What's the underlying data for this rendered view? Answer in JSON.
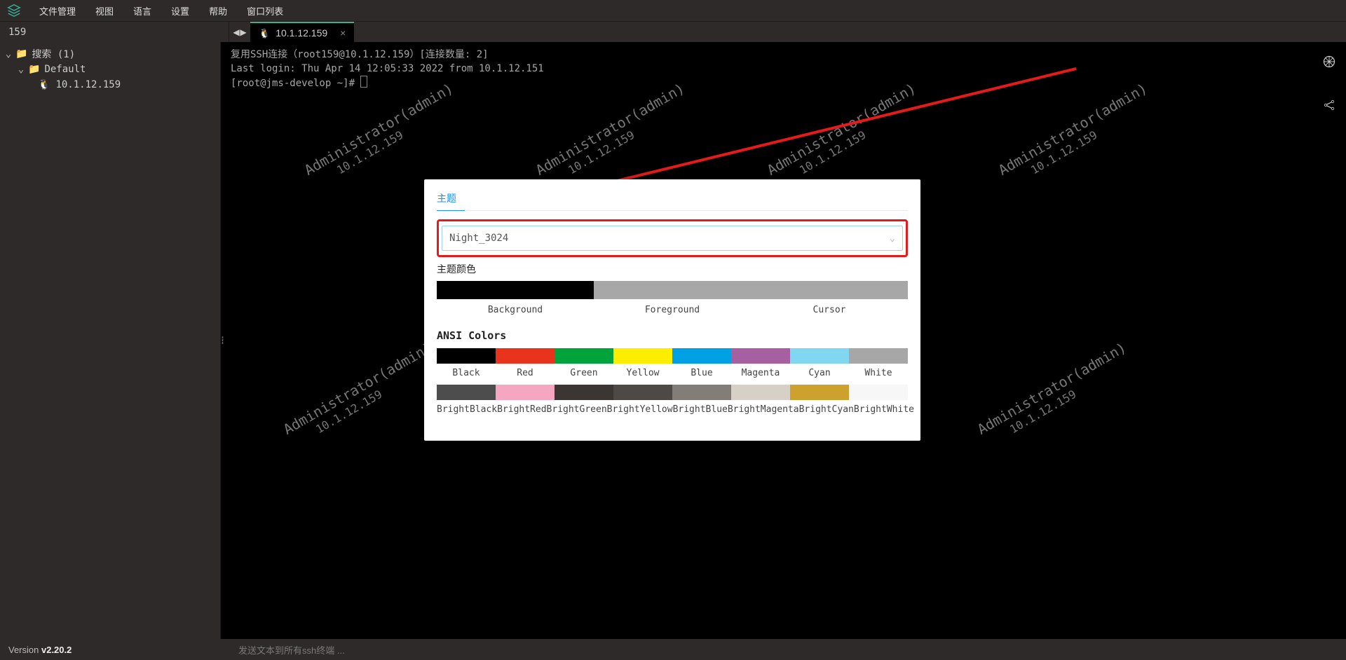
{
  "menu": {
    "items": [
      "文件管理",
      "视图",
      "语言",
      "设置",
      "帮助",
      "窗口列表"
    ]
  },
  "sidebar_title": "159",
  "tab": {
    "label": "10.1.12.159"
  },
  "tree": {
    "root_label": "搜索 (1)",
    "group_label": "Default",
    "host_label": "10.1.12.159"
  },
  "terminal": {
    "l1": "复用SSH连接（root159@10.1.12.159）[连接数量: 2]",
    "l2": "Last login: Thu Apr 14 12:05:33 2022 from 10.1.12.151",
    "l3": "[root@jms-develop ~]# "
  },
  "watermark": {
    "line1": "Administrator(admin)",
    "line2": "10.1.12.159"
  },
  "modal": {
    "title": "主题",
    "select_value": "Night_3024",
    "theme_color_label": "主题颜色",
    "swatches": [
      {
        "label": "Background",
        "color": "#000000"
      },
      {
        "label": "Foreground",
        "color": "#a7a7a7"
      },
      {
        "label": "Cursor",
        "color": "#a7a7a7"
      }
    ],
    "ansi_title": "ANSI Colors",
    "ansi": [
      {
        "label": "Black",
        "color": "#000000"
      },
      {
        "label": "Red",
        "color": "#e8341c"
      },
      {
        "label": "Green",
        "color": "#00a43a"
      },
      {
        "label": "Yellow",
        "color": "#ffed00"
      },
      {
        "label": "Blue",
        "color": "#00a0e4"
      },
      {
        "label": "Magenta",
        "color": "#a65fa1"
      },
      {
        "label": "Cyan",
        "color": "#81d7ef"
      },
      {
        "label": "White",
        "color": "#a7a7a7"
      }
    ],
    "ansi_bright": [
      {
        "label": "BrightBlack",
        "color": "#4d4d4d"
      },
      {
        "label": "BrightRed",
        "color": "#f5a6c0"
      },
      {
        "label": "BrightGreen",
        "color": "#3b3633"
      },
      {
        "label": "BrightYellow",
        "color": "#4d4945"
      },
      {
        "label": "BrightBlue",
        "color": "#837d77"
      },
      {
        "label": "BrightMagenta",
        "color": "#d6d0c6"
      },
      {
        "label": "BrightCyan",
        "color": "#cda12e"
      },
      {
        "label": "BrightWhite",
        "color": "#f7f7f7"
      }
    ]
  },
  "footer": {
    "version_prefix": "Version ",
    "version": "v2.20.2",
    "sendall": "发送文本到所有ssh终端 ..."
  }
}
